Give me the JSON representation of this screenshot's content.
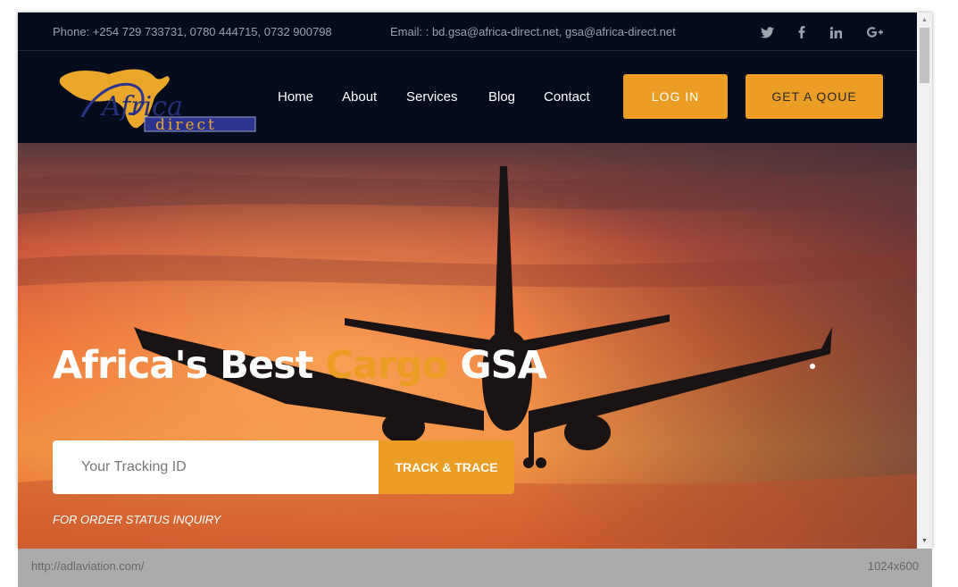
{
  "topbar": {
    "phone": "Phone: +254 729 733731, 0780 444715, 0732 900798",
    "email": "Email: : bd.gsa@africa-direct.net, gsa@africa-direct.net",
    "social": [
      "twitter-icon",
      "facebook-icon",
      "linkedin-icon",
      "google-plus-icon"
    ]
  },
  "logo": {
    "line1": "Africa",
    "line2": "direct"
  },
  "nav": {
    "items": [
      "Home",
      "About",
      "Services",
      "Blog",
      "Contact"
    ],
    "login_label": "LOG IN",
    "quote_label": "GET A QOUE"
  },
  "hero": {
    "title_part1": "Africa's Best ",
    "title_accent": "Cargo",
    "title_part2": " GSA",
    "tracking_placeholder": "Your Tracking ID",
    "track_button": "TRACK & TRACE",
    "caption": "FOR ORDER STATUS INQUIRY"
  },
  "statusbar": {
    "url": "http://adlaviation.com/",
    "size": "1024x600"
  },
  "colors": {
    "accent": "#eb9d26",
    "navy": "#040b1c"
  }
}
